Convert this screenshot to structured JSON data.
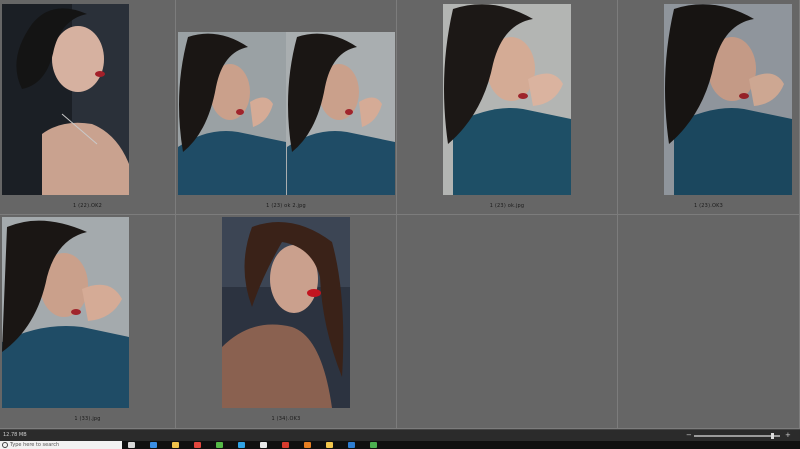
{
  "photos": [
    {
      "caption": "1 (22).OK2"
    },
    {
      "caption": "1 (23) ok 2.jpg"
    },
    {
      "caption": "1 (23) ok.jpg"
    },
    {
      "caption": "1 (23).OK3"
    },
    {
      "caption": "1 (33).jpg"
    },
    {
      "caption": "1 (34).OK3"
    }
  ],
  "status": {
    "text": "12.78 MB"
  },
  "zoom": {
    "level": 0.93
  },
  "taskbar": {
    "search_placeholder": "Type here to search",
    "apps": [
      {
        "name": "task-view",
        "color": "#d8d8d8"
      },
      {
        "name": "edge",
        "color": "#3a8ee6"
      },
      {
        "name": "explorer",
        "color": "#f0c24b"
      },
      {
        "name": "chrome",
        "color": "#e2463d"
      },
      {
        "name": "chrome-2",
        "color": "#55b947"
      },
      {
        "name": "photoshop",
        "color": "#2fa3e6"
      },
      {
        "name": "app-white",
        "color": "#e8e8e8"
      },
      {
        "name": "app-red",
        "color": "#d83b2e"
      },
      {
        "name": "app-orange",
        "color": "#e67e22"
      },
      {
        "name": "folder",
        "color": "#f3c64c"
      },
      {
        "name": "app-blue",
        "color": "#2d7dd2"
      },
      {
        "name": "app-green",
        "color": "#4caf50"
      }
    ]
  }
}
